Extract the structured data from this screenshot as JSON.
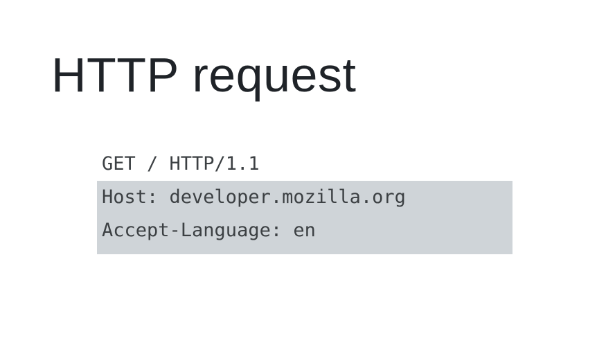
{
  "slide": {
    "title": "HTTP request"
  },
  "request": {
    "request_line": "GET / HTTP/1.1",
    "headers": [
      "Host: developer.mozilla.org",
      "Accept-Language: en"
    ],
    "highlight_color": "#cfd4d8"
  }
}
